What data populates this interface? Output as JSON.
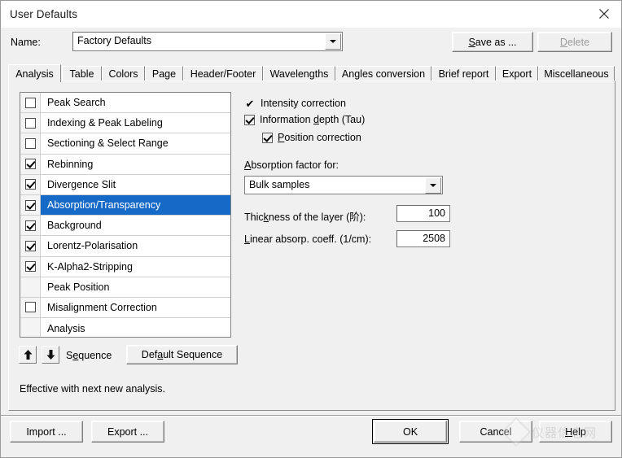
{
  "window": {
    "title": "User Defaults",
    "close_icon": "close-icon"
  },
  "name_row": {
    "label": "Name:",
    "value": "Factory Defaults",
    "dropdown_icon": "chevron-down-icon",
    "save_as_label": "Save as ...",
    "save_as_accel": "S",
    "delete_label": "Delete",
    "delete_accel": "D",
    "delete_disabled": true
  },
  "tabs": [
    {
      "label": "Analysis",
      "active": true
    },
    {
      "label": "Table",
      "active": false
    },
    {
      "label": "Colors",
      "active": false
    },
    {
      "label": "Page",
      "active": false
    },
    {
      "label": "Header/Footer",
      "active": false
    },
    {
      "label": "Wavelengths",
      "active": false
    },
    {
      "label": "Angles conversion",
      "active": false
    },
    {
      "label": "Brief report",
      "active": false
    },
    {
      "label": "Export",
      "active": false
    },
    {
      "label": "Miscellaneous",
      "active": false
    }
  ],
  "sequence_list": [
    {
      "label": "Peak Search",
      "has_checkbox": true,
      "checked": false,
      "selected": false
    },
    {
      "label": "Indexing & Peak Labeling",
      "has_checkbox": true,
      "checked": false,
      "selected": false
    },
    {
      "label": "Sectioning & Select Range",
      "has_checkbox": true,
      "checked": false,
      "selected": false
    },
    {
      "label": "Rebinning",
      "has_checkbox": true,
      "checked": true,
      "selected": false
    },
    {
      "label": "Divergence Slit",
      "has_checkbox": true,
      "checked": true,
      "selected": false
    },
    {
      "label": "Absorption/Transparency",
      "has_checkbox": true,
      "checked": true,
      "selected": true
    },
    {
      "label": "Background",
      "has_checkbox": true,
      "checked": true,
      "selected": false
    },
    {
      "label": "Lorentz-Polarisation",
      "has_checkbox": true,
      "checked": true,
      "selected": false
    },
    {
      "label": "K-Alpha2-Stripping",
      "has_checkbox": true,
      "checked": true,
      "selected": false
    },
    {
      "label": "Peak Position",
      "has_checkbox": false,
      "checked": false,
      "selected": false
    },
    {
      "label": "Misalignment Correction",
      "has_checkbox": true,
      "checked": false,
      "selected": false
    },
    {
      "label": "Analysis",
      "has_checkbox": false,
      "checked": false,
      "selected": false
    }
  ],
  "sequence_controls": {
    "move_up_icon": "arrow-up-icon",
    "move_down_icon": "arrow-down-icon",
    "sequence_label": "Sequence",
    "sequence_accel": "e",
    "default_sequence_label": "Default Sequence",
    "default_sequence_accel": "a",
    "note": "Effective with next new analysis."
  },
  "options": {
    "intensity_correction": {
      "label": "Intensity correction",
      "check_glyph": "✔",
      "checked": true,
      "boxed": false
    },
    "information_depth": {
      "label_before": "Information ",
      "label_accel": "d",
      "label_after": "epth (Tau)",
      "full_label": "Information depth (Tau)",
      "checked": true
    },
    "position_correction": {
      "label_accel": "P",
      "label_after": "osition correction",
      "full_label": "Position correction",
      "checked": true
    }
  },
  "absorption": {
    "group_label_accel": "A",
    "group_label_after": "bsorption factor for:",
    "group_label_full": "Absorption factor for:",
    "selected_option": "Bulk samples",
    "dropdown_icon": "chevron-down-icon",
    "thickness": {
      "label_accel": "k",
      "label_before": "Thic",
      "label_after": "ness of the layer (阶):",
      "full_label": "Thickness of the layer (阶):",
      "value": "100"
    },
    "linear_absorption": {
      "label_accel": "L",
      "label_after": "inear absorp.  coeff. (1/cm):",
      "full_label": "Linear absorp.  coeff. (1/cm):",
      "value": "2508"
    }
  },
  "footer": {
    "import_label": "Import ...",
    "export_label": "Export ...",
    "ok_label": "OK",
    "cancel_label": "Cancel",
    "help_label": "Help",
    "help_accel": "H"
  },
  "watermark": {
    "text": "仪器信息网"
  },
  "colors": {
    "selection_blue": "#1569c7",
    "dialog_face": "#f0f0f0",
    "field_white": "#ffffff",
    "disabled_text": "#9b9b9b",
    "border_gray": "#828282"
  }
}
